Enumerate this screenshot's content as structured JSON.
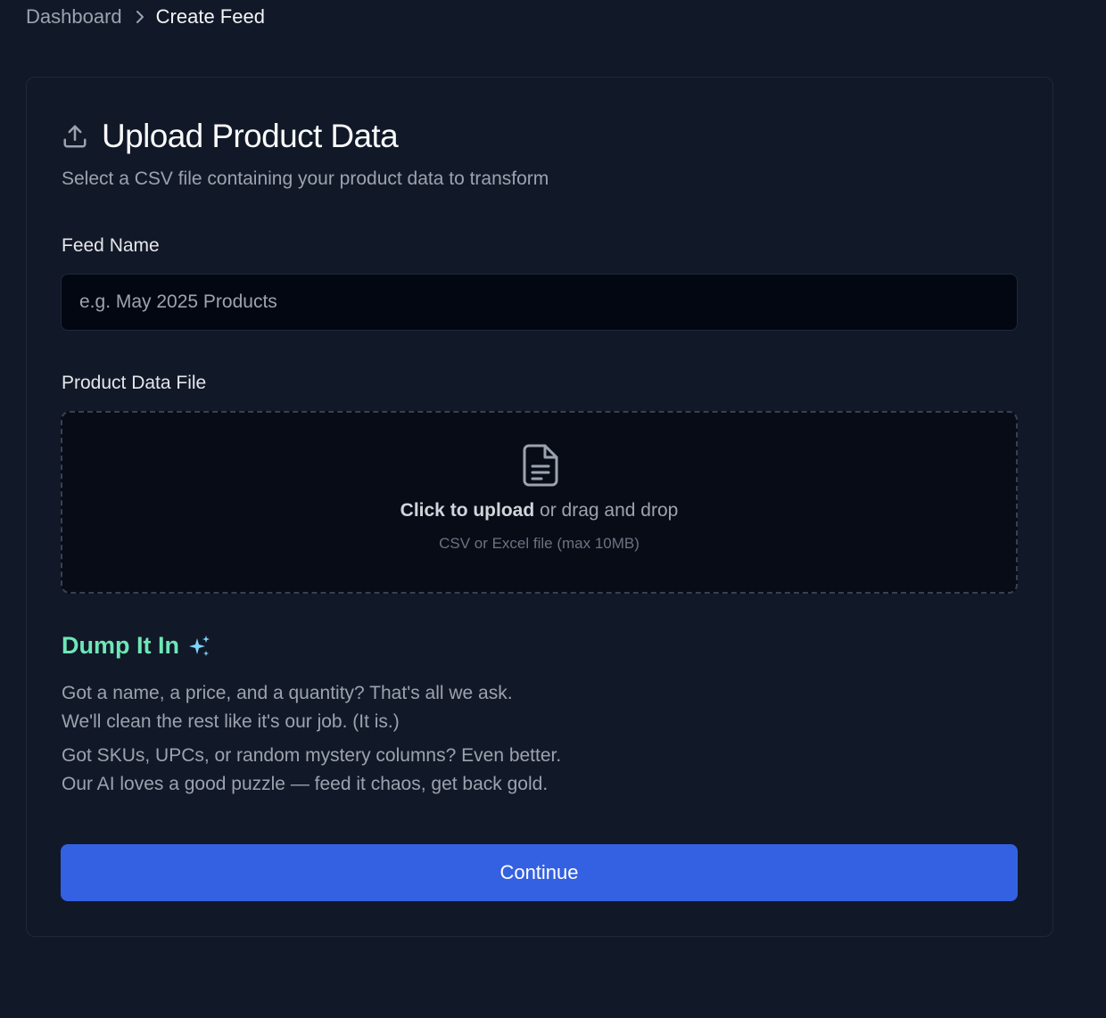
{
  "breadcrumb": {
    "items": [
      {
        "label": "Dashboard"
      },
      {
        "label": "Create Feed"
      }
    ]
  },
  "card": {
    "icon": "upload-icon",
    "title": "Upload Product Data",
    "subtitle": "Select a CSV file containing your product data to transform"
  },
  "feed_name": {
    "label": "Feed Name",
    "value": "",
    "placeholder": "e.g. May 2025 Products"
  },
  "file_upload": {
    "label": "Product Data File",
    "icon": "file-icon",
    "cta_strong": "Click to upload",
    "cta_rest": "or drag and drop",
    "hint": "CSV or Excel file (max 10MB)"
  },
  "promo": {
    "title": "Dump It In",
    "icon": "sparkles-icon",
    "paragraphs": [
      {
        "line1": "Got a name, a price, and a quantity? That's all we ask.",
        "line2": "We'll clean the rest like it's our job. (It is.)"
      },
      {
        "line1": "Got SKUs, UPCs, or random mystery columns? Even better.",
        "line2": "Our AI loves a good puzzle — feed it chaos, get back gold."
      }
    ]
  },
  "actions": {
    "continue_label": "Continue"
  },
  "colors": {
    "background": "#111827",
    "accent": "#3461e1",
    "promo_title": "#6ee7b7",
    "sparkle": "#7dd3fc"
  }
}
